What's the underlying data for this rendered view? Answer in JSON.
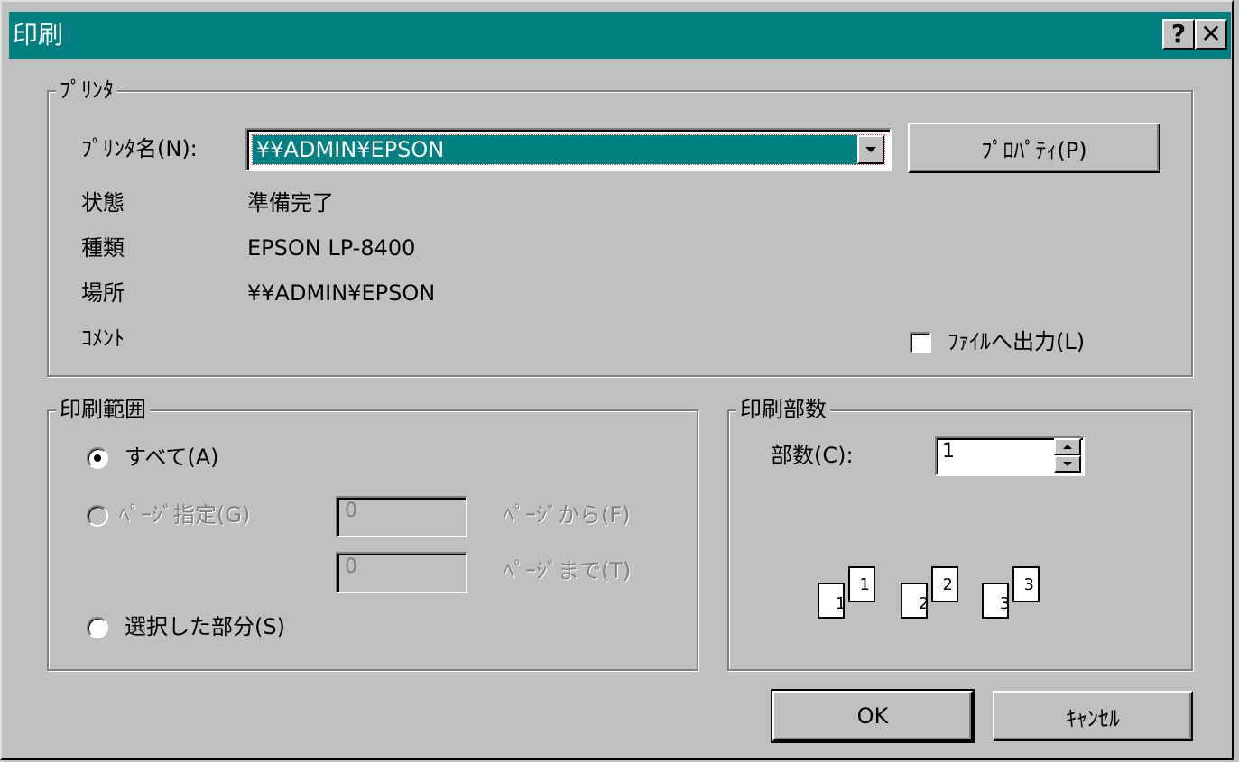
{
  "window": {
    "title": "印刷",
    "help_label": "?",
    "close_label": "✕"
  },
  "printer_group": {
    "label": "ﾌﾟﾘﾝﾀ",
    "name_label": "ﾌﾟﾘﾝﾀ名(N):",
    "name_value": "¥¥ADMIN¥EPSON",
    "properties_button": "ﾌﾟﾛﾊﾟﾃｨ(P)",
    "status_label": "状態",
    "status_value": "準備完了",
    "type_label": "種類",
    "type_value": "EPSON LP-8400",
    "location_label": "場所",
    "location_value": "¥¥ADMIN¥EPSON",
    "comment_label": "ｺﾒﾝﾄ",
    "comment_value": "",
    "print_to_file_label": "ﾌｧｲﾙへ出力(L)",
    "print_to_file_checked": false
  },
  "range_group": {
    "label": "印刷範囲",
    "all_label": "すべて(A)",
    "pages_label": "ﾍﾟｰｼﾞ指定(G)",
    "from_value": "0",
    "from_label": "ﾍﾟｰｼﾞから(F)",
    "to_value": "0",
    "to_label": "ﾍﾟｰｼﾞまで(T)",
    "selection_label": "選択した部分(S)",
    "selected": "all"
  },
  "copies_group": {
    "label": "印刷部数",
    "copies_label": "部数(C):",
    "copies_value": "1",
    "collate_pages": [
      "1",
      "1",
      "2",
      "2",
      "3",
      "3"
    ]
  },
  "buttons": {
    "ok": "OK",
    "cancel": "ｷｬﾝｾﾙ"
  }
}
